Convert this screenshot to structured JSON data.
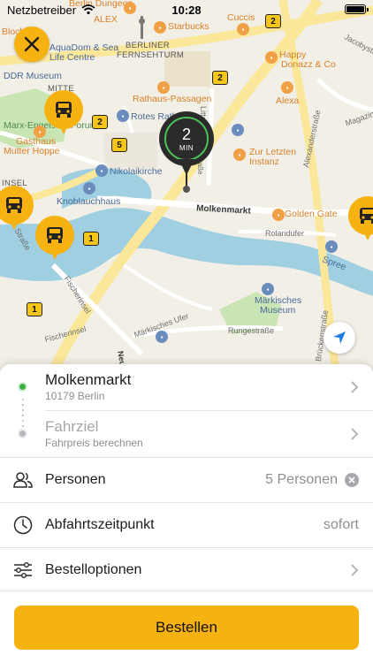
{
  "status_bar": {
    "carrier": "Netzbetreiber",
    "time": "10:28",
    "wifi_icon": "wifi-icon",
    "battery_icon": "battery-icon"
  },
  "map": {
    "labels": {
      "alex": "ALEX",
      "cuccis": "Cuccis",
      "starbucks": "Starbucks",
      "dungeon": "Berlin Dungeon",
      "block": "Block",
      "aquadom": "AquaDom & Sea",
      "life_centre": "Life Centre",
      "berliner": "BERLINER",
      "fernsehturm": "FERNSEHTURM",
      "happy": "Happy",
      "donazz": "Donazz & Co",
      "jacoby": "Jacobystr",
      "ddr_museum": "DDR Museum",
      "mitte": "MITTE",
      "marx_engels": "Marx-Engels",
      "forum": "Forum",
      "rathaus_passagen": "Rathaus-Passagen",
      "alexa": "Alexa",
      "rotes_rathaus": "Rotes Rathaus",
      "littenstr": "Littenstraße",
      "magazin": "Magazin",
      "gasthaus": "Gasthaus",
      "mutter_hoppe": "Mutter Hoppe",
      "nikolaikirche": "Nikolaikirche",
      "zur_letzten": "Zur Letzten",
      "instanz": "Instanz",
      "alexanderstr": "Alexanderstraße",
      "insel": "INSEL",
      "knoblauchhaus": "Knoblauchhaus",
      "molkenmarkt": "Molkenmarkt",
      "golden_gate": "Golden Gate",
      "kloster": "Klosterstraße",
      "rolandufer": "Rolandufer",
      "spree": "Spree",
      "fischerinsel": "Fischerinsel",
      "fischerinsel2": "Fischerinsel",
      "maerkisches": "Märkisches",
      "museum": "Museum",
      "maerkisches_ufer": "Märkisches Ufer",
      "rungestr": "Rungestraße",
      "brueckenstr": "Brückenstraße",
      "neue": "Neue",
      "strasse": "Straße"
    },
    "road_badges": [
      "2",
      "2",
      "2",
      "5",
      "1",
      "1"
    ],
    "eta": {
      "value": "2",
      "unit": "MIN"
    },
    "close_icon": "close-icon",
    "locate_icon": "location-arrow-icon",
    "taxi_icon": "taxi-icon"
  },
  "route": {
    "pickup": {
      "title": "Molkenmarkt",
      "subtitle": "10179 Berlin"
    },
    "destination": {
      "title": "Fahrziel",
      "subtitle": "Fahrpreis berechnen"
    }
  },
  "options": {
    "passengers": {
      "label": "Personen",
      "value": "5 Personen",
      "icon": "people-icon"
    },
    "departure": {
      "label": "Abfahrtszeitpunkt",
      "value": "sofort",
      "icon": "clock-icon"
    },
    "order_options": {
      "label": "Bestelloptionen",
      "icon": "sliders-icon"
    }
  },
  "order_button": {
    "label": "Bestellen"
  },
  "colors": {
    "accent": "#f6b211",
    "pickup_dot": "#3cb043",
    "eta_ring": "#4cc25a",
    "river": "#9fcfe0",
    "park": "#c9e5b4"
  }
}
